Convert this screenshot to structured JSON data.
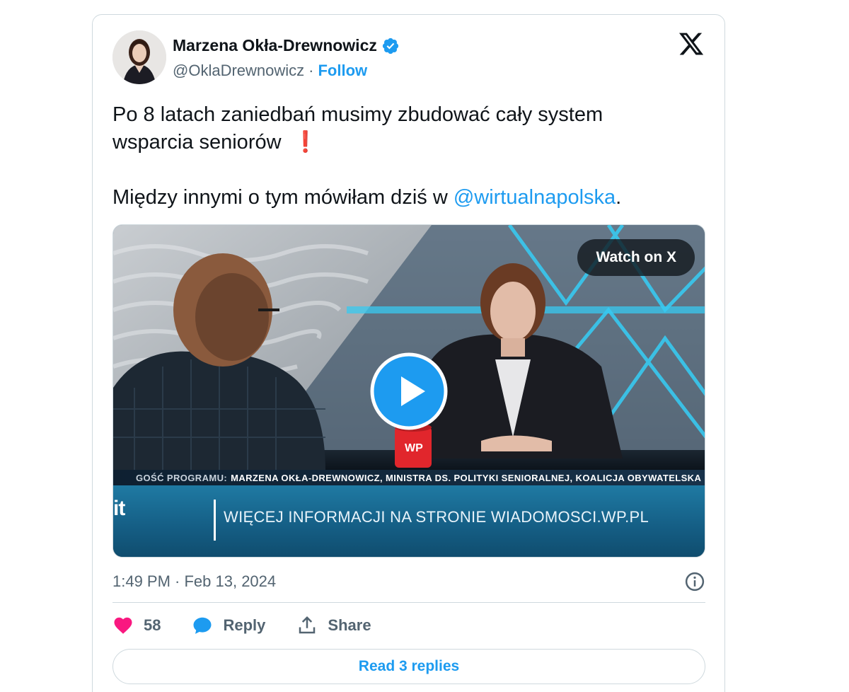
{
  "author": {
    "name": "Marzena Okła-Drewnowicz",
    "handle": "@OklaDrewnowicz",
    "separator": "·",
    "follow_label": "Follow",
    "verified_icon": "verified-badge-icon"
  },
  "tweet": {
    "line1": "Po 8 latach zaniedbań musimy zbudować cały system",
    "line2": "wsparcia seniorów",
    "line2_emoji": "❗",
    "line3_prefix": "Między innymi o tym mówiłam dziś w",
    "mention": "@wirtualnapolska",
    "line3_suffix": "."
  },
  "media": {
    "watch_label": "Watch on X",
    "lower_third_label": "GOŚĆ PROGRAMU:",
    "lower_third_text": "MARZENA OKŁA-DREWNOWICZ, MINISTRA DS. POLITYKI SENIORALNEJ, KOALICJA OBYWATELSKA",
    "info_text": "WIĘCEJ INFORMACJI NA STRONIE WIADOMOSCI.WP.PL",
    "logo_fragment": "it",
    "mug_logo": "WP"
  },
  "meta": {
    "timestamp": "1:49 PM · Feb 13, 2024"
  },
  "actions": {
    "like_count": "58",
    "reply_label": "Reply",
    "share_label": "Share"
  },
  "replies_button": "Read 3 replies",
  "colors": {
    "accent": "#1d9bf0",
    "like": "#f91880",
    "text_secondary": "#536471",
    "border": "#cfd9de"
  }
}
